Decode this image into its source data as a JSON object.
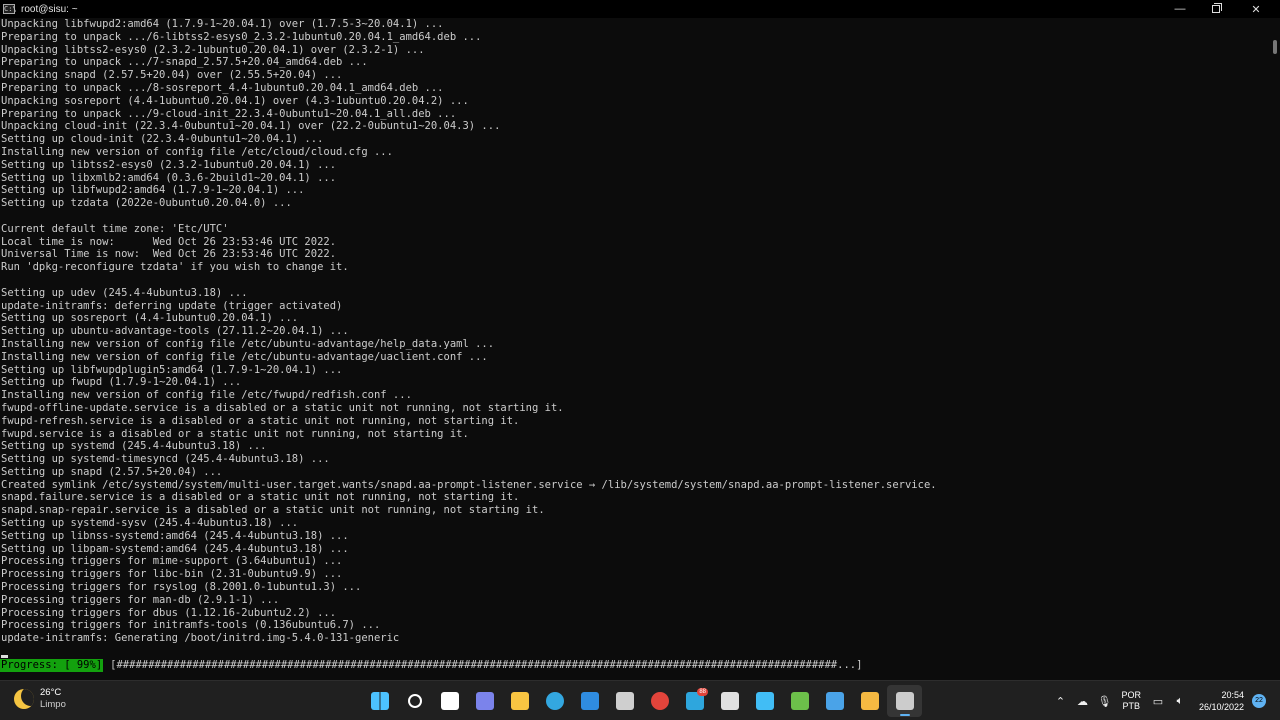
{
  "window": {
    "title": "root@sisu: ~"
  },
  "terminal": {
    "lines": [
      "Unpacking libfwupd2:amd64 (1.7.9-1~20.04.1) over (1.7.5-3~20.04.1) ...",
      "Preparing to unpack .../6-libtss2-esys0_2.3.2-1ubuntu0.20.04.1_amd64.deb ...",
      "Unpacking libtss2-esys0 (2.3.2-1ubuntu0.20.04.1) over (2.3.2-1) ...",
      "Preparing to unpack .../7-snapd_2.57.5+20.04_amd64.deb ...",
      "Unpacking snapd (2.57.5+20.04) over (2.55.5+20.04) ...",
      "Preparing to unpack .../8-sosreport_4.4-1ubuntu0.20.04.1_amd64.deb ...",
      "Unpacking sosreport (4.4-1ubuntu0.20.04.1) over (4.3-1ubuntu0.20.04.2) ...",
      "Preparing to unpack .../9-cloud-init_22.3.4-0ubuntu1~20.04.1_all.deb ...",
      "Unpacking cloud-init (22.3.4-0ubuntu1~20.04.1) over (22.2-0ubuntu1~20.04.3) ...",
      "Setting up cloud-init (22.3.4-0ubuntu1~20.04.1) ...",
      "Installing new version of config file /etc/cloud/cloud.cfg ...",
      "Setting up libtss2-esys0 (2.3.2-1ubuntu0.20.04.1) ...",
      "Setting up libxmlb2:amd64 (0.3.6-2build1~20.04.1) ...",
      "Setting up libfwupd2:amd64 (1.7.9-1~20.04.1) ...",
      "Setting up tzdata (2022e-0ubuntu0.20.04.0) ...",
      "",
      "Current default time zone: 'Etc/UTC'",
      "Local time is now:      Wed Oct 26 23:53:46 UTC 2022.",
      "Universal Time is now:  Wed Oct 26 23:53:46 UTC 2022.",
      "Run 'dpkg-reconfigure tzdata' if you wish to change it.",
      "",
      "Setting up udev (245.4-4ubuntu3.18) ...",
      "update-initramfs: deferring update (trigger activated)",
      "Setting up sosreport (4.4-1ubuntu0.20.04.1) ...",
      "Setting up ubuntu-advantage-tools (27.11.2~20.04.1) ...",
      "Installing new version of config file /etc/ubuntu-advantage/help_data.yaml ...",
      "Installing new version of config file /etc/ubuntu-advantage/uaclient.conf ...",
      "Setting up libfwupdplugin5:amd64 (1.7.9-1~20.04.1) ...",
      "Setting up fwupd (1.7.9-1~20.04.1) ...",
      "Installing new version of config file /etc/fwupd/redfish.conf ...",
      "fwupd-offline-update.service is a disabled or a static unit not running, not starting it.",
      "fwupd-refresh.service is a disabled or a static unit not running, not starting it.",
      "fwupd.service is a disabled or a static unit not running, not starting it.",
      "Setting up systemd (245.4-4ubuntu3.18) ...",
      "Setting up systemd-timesyncd (245.4-4ubuntu3.18) ...",
      "Setting up snapd (2.57.5+20.04) ...",
      "Created symlink /etc/systemd/system/multi-user.target.wants/snapd.aa-prompt-listener.service → /lib/systemd/system/snapd.aa-prompt-listener.service.",
      "snapd.failure.service is a disabled or a static unit not running, not starting it.",
      "snapd.snap-repair.service is a disabled or a static unit not running, not starting it.",
      "Setting up systemd-sysv (245.4-4ubuntu3.18) ...",
      "Setting up libnss-systemd:amd64 (245.4-4ubuntu3.18) ...",
      "Setting up libpam-systemd:amd64 (245.4-4ubuntu3.18) ...",
      "Processing triggers for mime-support (3.64ubuntu1) ...",
      "Processing triggers for libc-bin (2.31-0ubuntu9.9) ...",
      "Processing triggers for rsyslog (8.2001.0-1ubuntu1.3) ...",
      "Processing triggers for man-db (2.9.1-1) ...",
      "Processing triggers for dbus (1.12.16-2ubuntu2.2) ...",
      "Processing triggers for initramfs-tools (0.136ubuntu6.7) ...",
      "update-initramfs: Generating /boot/initrd.img-5.4.0-131-generic"
    ],
    "progress_label": "Progress: [ 99%]",
    "progress_bar": "[##################################################################################################################...]",
    "progress_percent": 99
  },
  "taskbar": {
    "weather_temp": "26°C",
    "weather_condition": "Limpo",
    "apps": [
      {
        "icon": "windows-start-icon",
        "glyph": "",
        "color": "#4cc2ff"
      },
      {
        "icon": "search-icon",
        "glyph": "",
        "color": "#ffffff"
      },
      {
        "icon": "task-view-icon",
        "glyph": "",
        "color": "#ffffff"
      },
      {
        "icon": "chat-icon",
        "glyph": "",
        "color": "#7b83eb"
      },
      {
        "icon": "file-explorer-icon",
        "glyph": "",
        "color": "#f8c542"
      },
      {
        "icon": "edge-icon",
        "glyph": "",
        "color": "#33a7e0"
      },
      {
        "icon": "store-icon",
        "glyph": "",
        "color": "#2f8ce0"
      },
      {
        "icon": "paint-icon",
        "glyph": "",
        "color": "#cfcfcf"
      },
      {
        "icon": "chrome-icon",
        "glyph": "",
        "color": "#e2443b"
      },
      {
        "icon": "telegram-icon",
        "glyph": "",
        "color": "#2ea6dd",
        "badge": "88"
      },
      {
        "icon": "3d-box-icon",
        "glyph": "",
        "color": "#e0e0e0"
      },
      {
        "icon": "home-assistant-icon",
        "glyph": "",
        "color": "#41bdf5"
      },
      {
        "icon": "notepad-icon",
        "glyph": "",
        "color": "#6cc04a"
      },
      {
        "icon": "photos-icon",
        "glyph": "",
        "color": "#4aa3e8"
      },
      {
        "icon": "sticky-tool-icon",
        "glyph": "",
        "color": "#f5b942"
      },
      {
        "icon": "terminal-icon",
        "glyph": "",
        "color": "#cccccc",
        "active": true
      }
    ],
    "language": "POR",
    "keyboard": "PTB",
    "time": "20:54",
    "date": "26/10/2022",
    "notification_count": "22"
  }
}
